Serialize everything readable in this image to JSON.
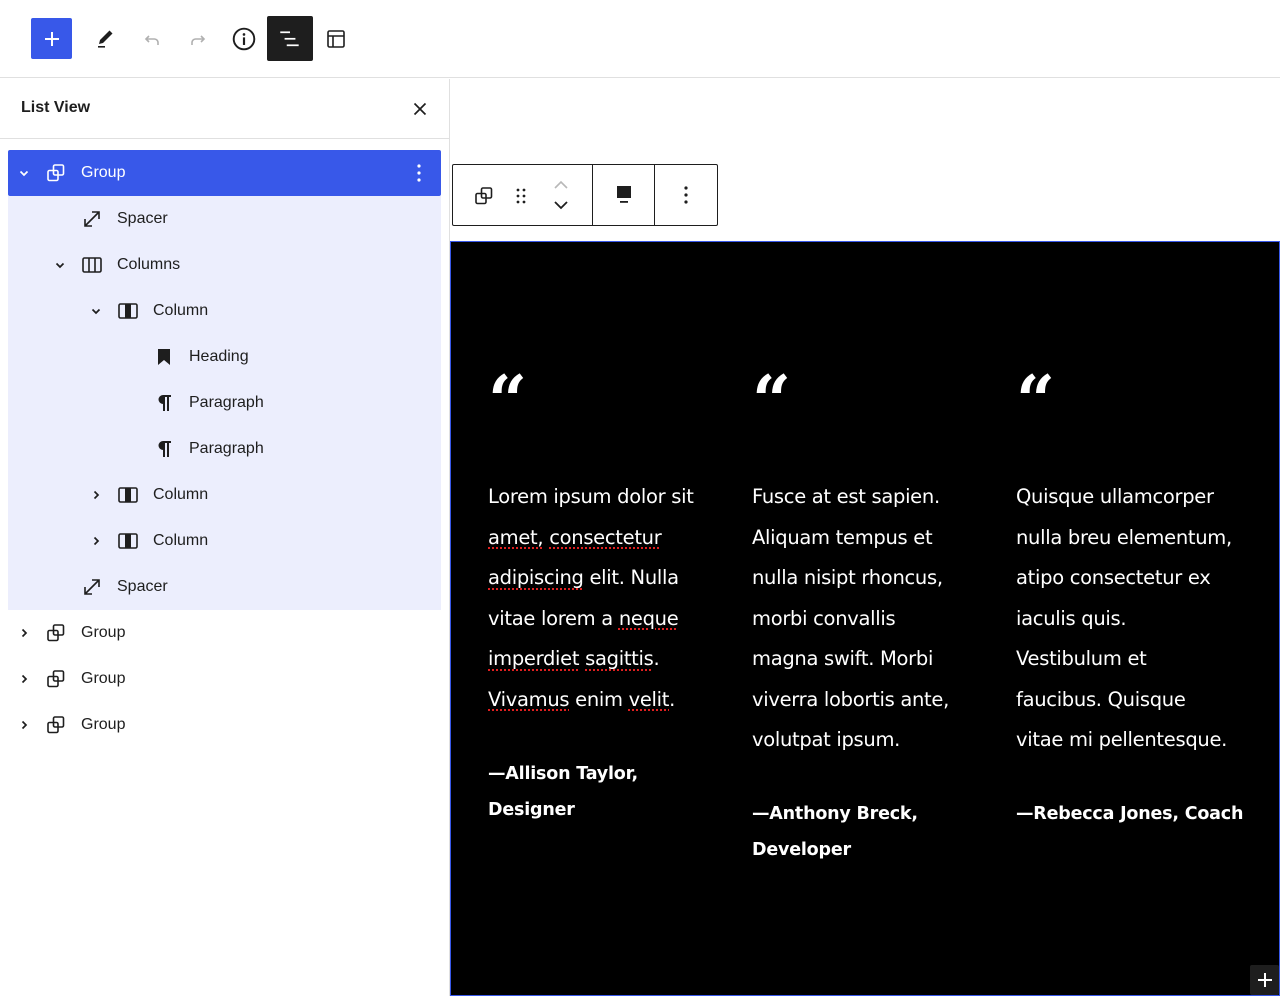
{
  "toolbar": {
    "buttons": [
      {
        "name": "add-block-button",
        "icon": "plus-icon"
      },
      {
        "name": "tools-button",
        "icon": "pencil-icon"
      },
      {
        "name": "undo-button",
        "icon": "undo-icon",
        "disabled": true
      },
      {
        "name": "redo-button",
        "icon": "redo-icon",
        "disabled": true
      },
      {
        "name": "details-button",
        "icon": "info-icon"
      },
      {
        "name": "list-view-button",
        "icon": "list-view-icon",
        "active": true
      },
      {
        "name": "document-overview-button",
        "icon": "layout-icon"
      }
    ]
  },
  "list_view": {
    "title": "List View",
    "close_icon": "close-icon",
    "items": [
      {
        "label": "Group",
        "icon": "group-icon",
        "level": 0,
        "expanded": true,
        "selected": true
      },
      {
        "label": "Spacer",
        "icon": "spacer-icon",
        "level": 1
      },
      {
        "label": "Columns",
        "icon": "columns-icon",
        "level": 1,
        "expanded": true
      },
      {
        "label": "Column",
        "icon": "column-icon",
        "level": 2,
        "expanded": true
      },
      {
        "label": "Heading",
        "icon": "bookmark-icon",
        "level": 3
      },
      {
        "label": "Paragraph",
        "icon": "paragraph-icon",
        "level": 3
      },
      {
        "label": "Paragraph",
        "icon": "paragraph-icon",
        "level": 3
      },
      {
        "label": "Column",
        "icon": "column-icon",
        "level": 2,
        "expanded": false
      },
      {
        "label": "Column",
        "icon": "column-icon",
        "level": 2,
        "expanded": false
      },
      {
        "label": "Spacer",
        "icon": "spacer-icon",
        "level": 1
      },
      {
        "label": "Group",
        "icon": "group-icon",
        "level": 0,
        "expanded": false
      },
      {
        "label": "Group",
        "icon": "group-icon",
        "level": 0,
        "expanded": false
      },
      {
        "label": "Group",
        "icon": "group-icon",
        "level": 0,
        "expanded": false
      }
    ]
  },
  "block_toolbar": {
    "buttons": [
      "group-icon",
      "drag-handle-icon",
      "move-up-icon",
      "move-down-icon",
      "align-icon",
      "more-options-icon"
    ]
  },
  "canvas": {
    "quote_mark": "“",
    "columns": [
      {
        "lines": [
          [
            {
              "t": "Lorem ipsum dolor sit"
            }
          ],
          [
            {
              "t": "amet,",
              "s": true
            },
            {
              "t": " "
            },
            {
              "t": "consectetur",
              "s": true
            }
          ],
          [
            {
              "t": "adipiscing",
              "s": true
            },
            {
              "t": " elit. Nulla"
            }
          ],
          [
            {
              "t": "vitae lorem a "
            },
            {
              "t": "neque",
              "s": true
            }
          ],
          [
            {
              "t": "imperdiet",
              "s": true
            },
            {
              "t": " "
            },
            {
              "t": "sagittis",
              "s": true
            },
            {
              "t": "."
            }
          ],
          [
            {
              "t": "Vivamus",
              "s": true
            },
            {
              "t": " enim "
            },
            {
              "t": "velit",
              "s": true
            },
            {
              "t": "."
            }
          ]
        ],
        "attribution_lines": [
          "—Allison Taylor,",
          "Designer"
        ]
      },
      {
        "lines": [
          [
            {
              "t": "Fusce at est sapien."
            }
          ],
          [
            {
              "t": "Aliquam tempus et"
            }
          ],
          [
            {
              "t": "nulla nisipt rhoncus,"
            }
          ],
          [
            {
              "t": "morbi convallis"
            }
          ],
          [
            {
              "t": "magna swift. Morbi"
            }
          ],
          [
            {
              "t": "viverra lobortis ante,"
            }
          ],
          [
            {
              "t": "volutpat ipsum."
            }
          ]
        ],
        "attribution_lines": [
          "—Anthony Breck,",
          "Developer"
        ]
      },
      {
        "lines": [
          [
            {
              "t": "Quisque ullamcorper"
            }
          ],
          [
            {
              "t": "nulla breu elementum,"
            }
          ],
          [
            {
              "t": "atipo consectetur ex"
            }
          ],
          [
            {
              "t": "iaculis quis."
            }
          ],
          [
            {
              "t": "Vestibulum et"
            }
          ],
          [
            {
              "t": "faucibus. Quisque"
            }
          ],
          [
            {
              "t": "vitae mi pellentesque."
            }
          ]
        ],
        "attribution_lines": [
          "—Rebecca Jones, Coach"
        ]
      }
    ],
    "appender_icon": "plus-icon"
  },
  "colors": {
    "accent": "#3858e9",
    "selection_highlight": "#eceefd",
    "canvas_background": "#000000",
    "spellcheck_underline": "#e02020"
  }
}
